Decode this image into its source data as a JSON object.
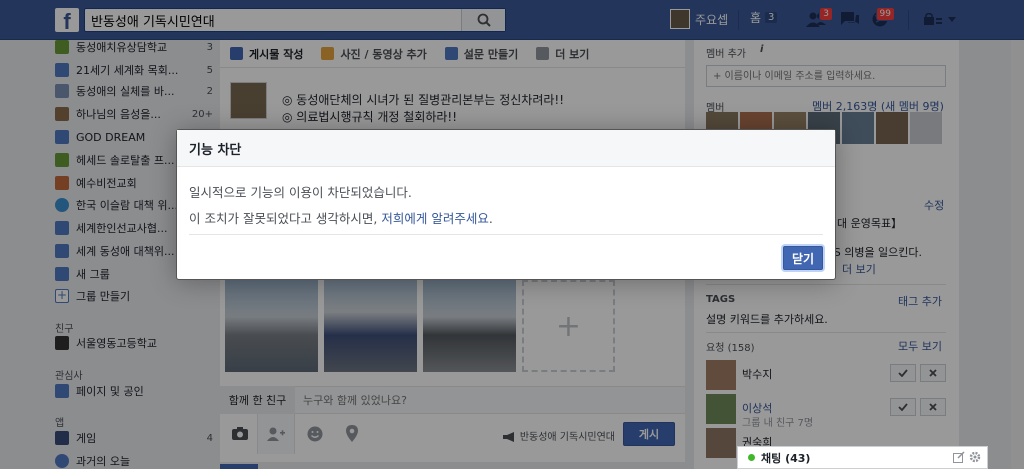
{
  "topbar": {
    "logo": "f",
    "search_value": "반동성애 기독시민연대",
    "profile_name": "주요셉",
    "home_label": "홈",
    "home_count": "3",
    "friend_requests_badge": "3",
    "notifications_badge": "99"
  },
  "sidebar": {
    "groups": [
      {
        "label": "동성애치유상담학교",
        "count": "3"
      },
      {
        "label": "21세기 세계화 목회...",
        "count": "5"
      },
      {
        "label": "동성애의 실체를 바...",
        "count": "2"
      },
      {
        "label": "하나님의 음성을...",
        "count": "20+"
      },
      {
        "label": "GOD DREAM",
        "count": ""
      },
      {
        "label": "헤세드 솔로탈출 프...",
        "count": ""
      },
      {
        "label": "예수비전교회",
        "count": ""
      },
      {
        "label": "한국 이슬람 대책 위...",
        "count": ""
      },
      {
        "label": "세계한인선교사협...",
        "count": ""
      },
      {
        "label": "세계 동성애 대책위...",
        "count": ""
      },
      {
        "label": "새 그룹",
        "count": ""
      },
      {
        "label": "그룹 만들기",
        "count": ""
      }
    ],
    "friends_heading": "친구",
    "friends_item": "서울영동고등학교",
    "interests_heading": "관심사",
    "interests_item": "페이지 및 공인",
    "apps_heading": "앱",
    "apps_items": [
      {
        "label": "게임",
        "count": "4"
      },
      {
        "label": "과거의 오늘",
        "count": ""
      }
    ]
  },
  "composer": {
    "tabs": [
      "게시물 작성",
      "사진 / 동영상 추가",
      "설문 만들기",
      "더 보기"
    ],
    "post_lines": [
      "◎ 동성애단체의 시녀가 된 질병관리본부는 정신차려라!!",
      "◎ 의료법시행규칙 개정 철회하라!!"
    ],
    "tag_label": "함께 한 친구",
    "tag_placeholder": "누구와 함께 있었나요?",
    "privacy_label": "반동성애 기독시민연대",
    "post_button": "게시"
  },
  "right_panel": {
    "add_members_label": "멤버 추가",
    "add_members_placeholder": "+ 이름이나 이메일 주소를 입력하세요.",
    "members_label": "멤버",
    "members_summary": "멤버 2,163명 (새 멤버 9명)",
    "edit_link": "수정",
    "description_fragment1": "7대 운영목표】",
    "description_fragment2": "N S 의병을 일으킨다.",
    "description_more": "더 보기",
    "tags_heading": "TAGS",
    "tags_add": "태그 추가",
    "tags_hint": "설명 키워드를 추가하세요.",
    "requests_heading": "요청 (158)",
    "requests_all": "모두 보기",
    "requests": [
      {
        "name": "박수지",
        "sub": ""
      },
      {
        "name": "이상석",
        "sub": "그룹 내 친구 7명"
      },
      {
        "name": "권숙희",
        "sub": ""
      }
    ]
  },
  "chat": {
    "label": "채팅 (43)"
  },
  "dialog": {
    "title": "기능 차단",
    "line1": "일시적으로 기능의 이용이 차단되었습니다.",
    "line2_prefix": "이 조치가 잘못되었다고 생각하시면, ",
    "line2_link": "저희에게 알려주세요",
    "line2_suffix": ".",
    "close_button": "닫기"
  },
  "colors": {
    "brand": "#3b5998",
    "button": "#4267b2",
    "link": "#365899",
    "badge": "#fa3e3e"
  }
}
